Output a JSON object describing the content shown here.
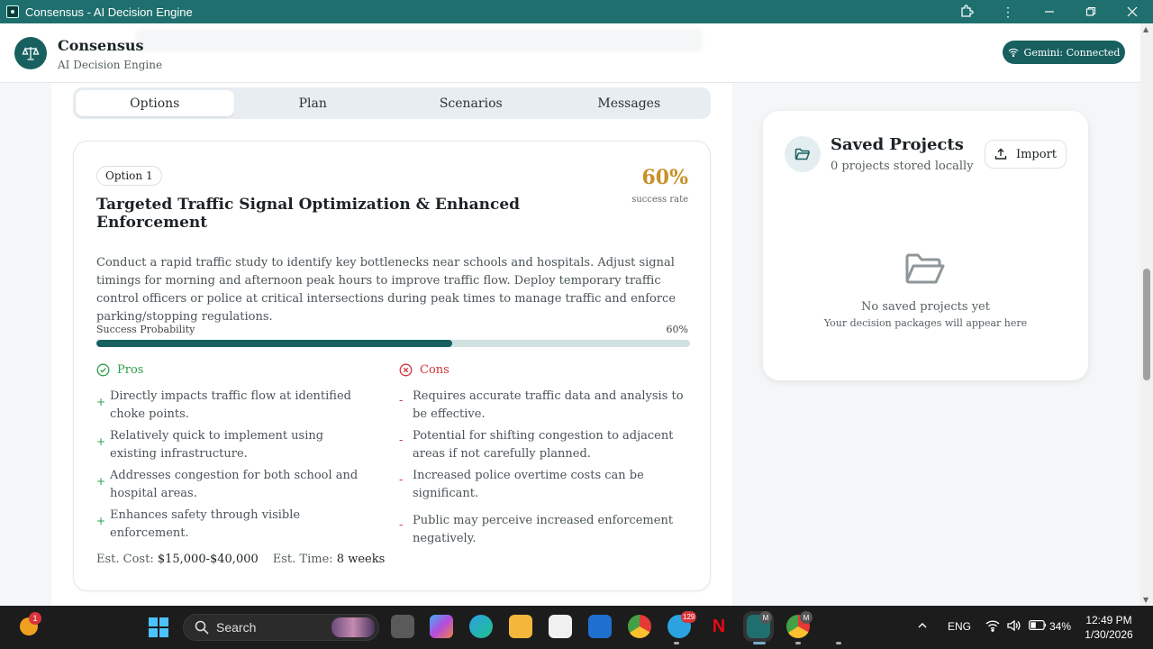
{
  "window": {
    "title": "Consensus - AI Decision Engine"
  },
  "header": {
    "brand_name": "Consensus",
    "brand_subtitle": "AI Decision Engine",
    "status_badge": "Gemini: Connected"
  },
  "tabs": [
    {
      "label": "Options",
      "active": true
    },
    {
      "label": "Plan",
      "active": false
    },
    {
      "label": "Scenarios",
      "active": false
    },
    {
      "label": "Messages",
      "active": false
    }
  ],
  "option": {
    "badge": "Option 1",
    "title": "Targeted Traffic Signal Optimization & Enhanced Enforcement",
    "success_rate": "60%",
    "success_rate_label": "success rate",
    "description": "Conduct a rapid traffic study to identify key bottlenecks near schools and hospitals. Adjust signal timings for morning and afternoon peak hours to improve traffic flow. Deploy temporary traffic control officers or police at critical intersections during peak times to manage traffic and enforce parking/stopping regulations.",
    "probability_label": "Success Probability",
    "probability_value": "60%",
    "probability_fraction": 0.6,
    "pros_heading": "Pros",
    "cons_heading": "Cons",
    "pros": [
      "Directly impacts traffic flow at identified choke points.",
      "Relatively quick to implement using existing infrastructure.",
      "Addresses congestion for both school and hospital areas.",
      "Enhances safety through visible enforcement."
    ],
    "cons": [
      "Requires accurate traffic data and analysis to be effective.",
      "Potential for shifting congestion to adjacent areas if not carefully planned.",
      "Increased police overtime costs can be significant.",
      "Public may perceive increased enforcement negatively."
    ],
    "pro_mark": "+",
    "con_mark": "-",
    "cost_label": "Est. Cost:",
    "cost_value": "$15,000-$40,000",
    "time_label": "Est. Time:",
    "time_value": "8 weeks"
  },
  "saved_projects": {
    "title": "Saved Projects",
    "subtitle": "0 projects stored locally",
    "import_label": "Import",
    "empty_title": "No saved projects yet",
    "empty_subtitle": "Your decision packages will appear here"
  },
  "taskbar": {
    "weather_badge": "1",
    "search_label": "Search",
    "telegram_badge": "129",
    "app_badge_m1": "M",
    "app_badge_m2": "M",
    "language": "ENG",
    "battery": "34%",
    "time": "12:49 PM",
    "date": "1/30/2026"
  },
  "colors": {
    "titlebar": "#1f6f6f",
    "accent": "#17605f",
    "success_rate": "#c8912b",
    "pros": "#2e9e4b",
    "cons": "#d3343a"
  }
}
